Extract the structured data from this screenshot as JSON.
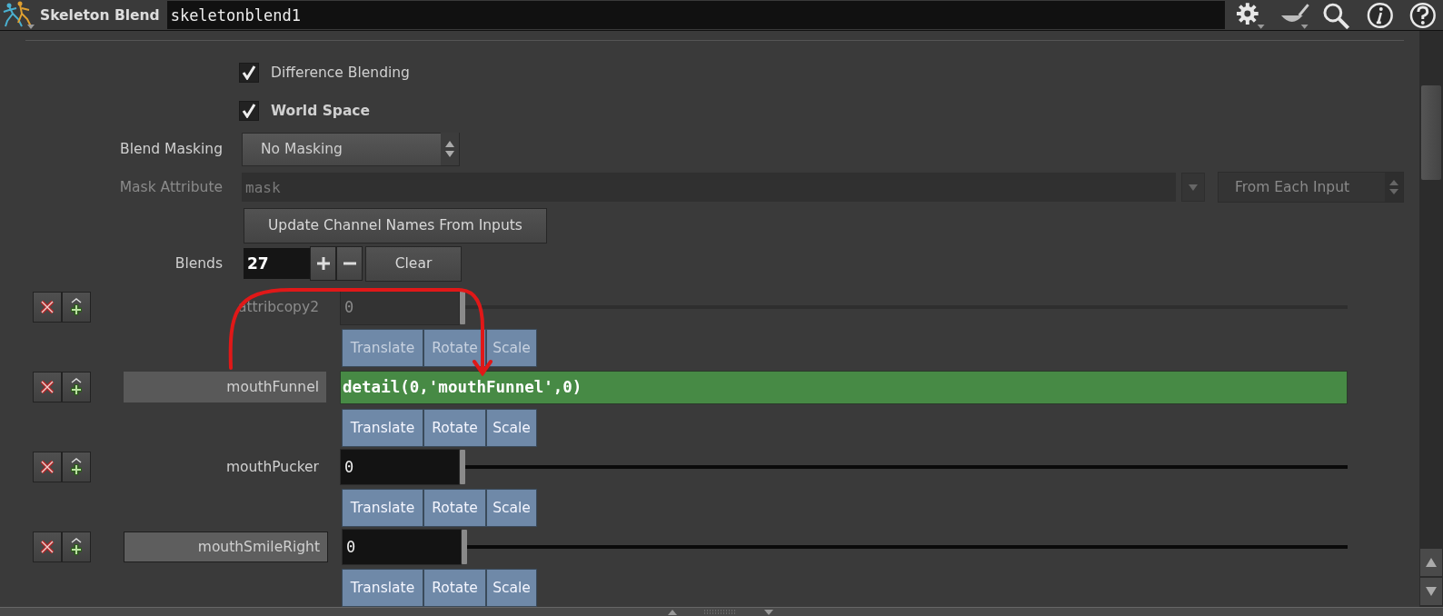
{
  "header": {
    "node_type": "Skeleton Blend",
    "node_name": "skeletonblend1"
  },
  "parameters": [
    {
      "kind": "checkbox",
      "label": "Difference Blending",
      "checked": true,
      "modified": false
    },
    {
      "kind": "checkbox",
      "label": "World Space",
      "checked": true,
      "modified": true
    },
    {
      "kind": "menu",
      "label": "Blend Masking",
      "value": "No Masking"
    },
    {
      "kind": "attribute",
      "label": "Mask Attribute",
      "value": "mask",
      "disabled": true,
      "mode": "From Each Input"
    },
    {
      "kind": "button",
      "label": "Update Channel Names From Inputs"
    },
    {
      "kind": "count",
      "label": "Blends",
      "value": "27",
      "clear": "Clear"
    }
  ],
  "blends": [
    {
      "label": {
        "kind": "plain",
        "text": "attribcopy2"
      },
      "disabled": true,
      "kind": "slider",
      "value": "0",
      "level": 0,
      "buttons": [
        "Translate",
        "Rotate",
        "Scale"
      ]
    },
    {
      "label": {
        "kind": "filled",
        "text": "mouthFunnel"
      },
      "disabled": false,
      "kind": "expression",
      "value": "detail(0,'mouthFunnel',0)",
      "buttons": [
        "Translate",
        "Rotate",
        "Scale"
      ]
    },
    {
      "label": {
        "kind": "plain",
        "text": "mouthPucker"
      },
      "disabled": false,
      "kind": "slider",
      "value": "0",
      "level": 0,
      "buttons": [
        "Translate",
        "Rotate",
        "Scale"
      ]
    },
    {
      "label": {
        "kind": "framed",
        "text": "mouthSmileRight"
      },
      "disabled": false,
      "kind": "slider",
      "value": "0",
      "level": 0,
      "buttons": [
        "Translate",
        "Rotate",
        "Scale"
      ]
    }
  ]
}
